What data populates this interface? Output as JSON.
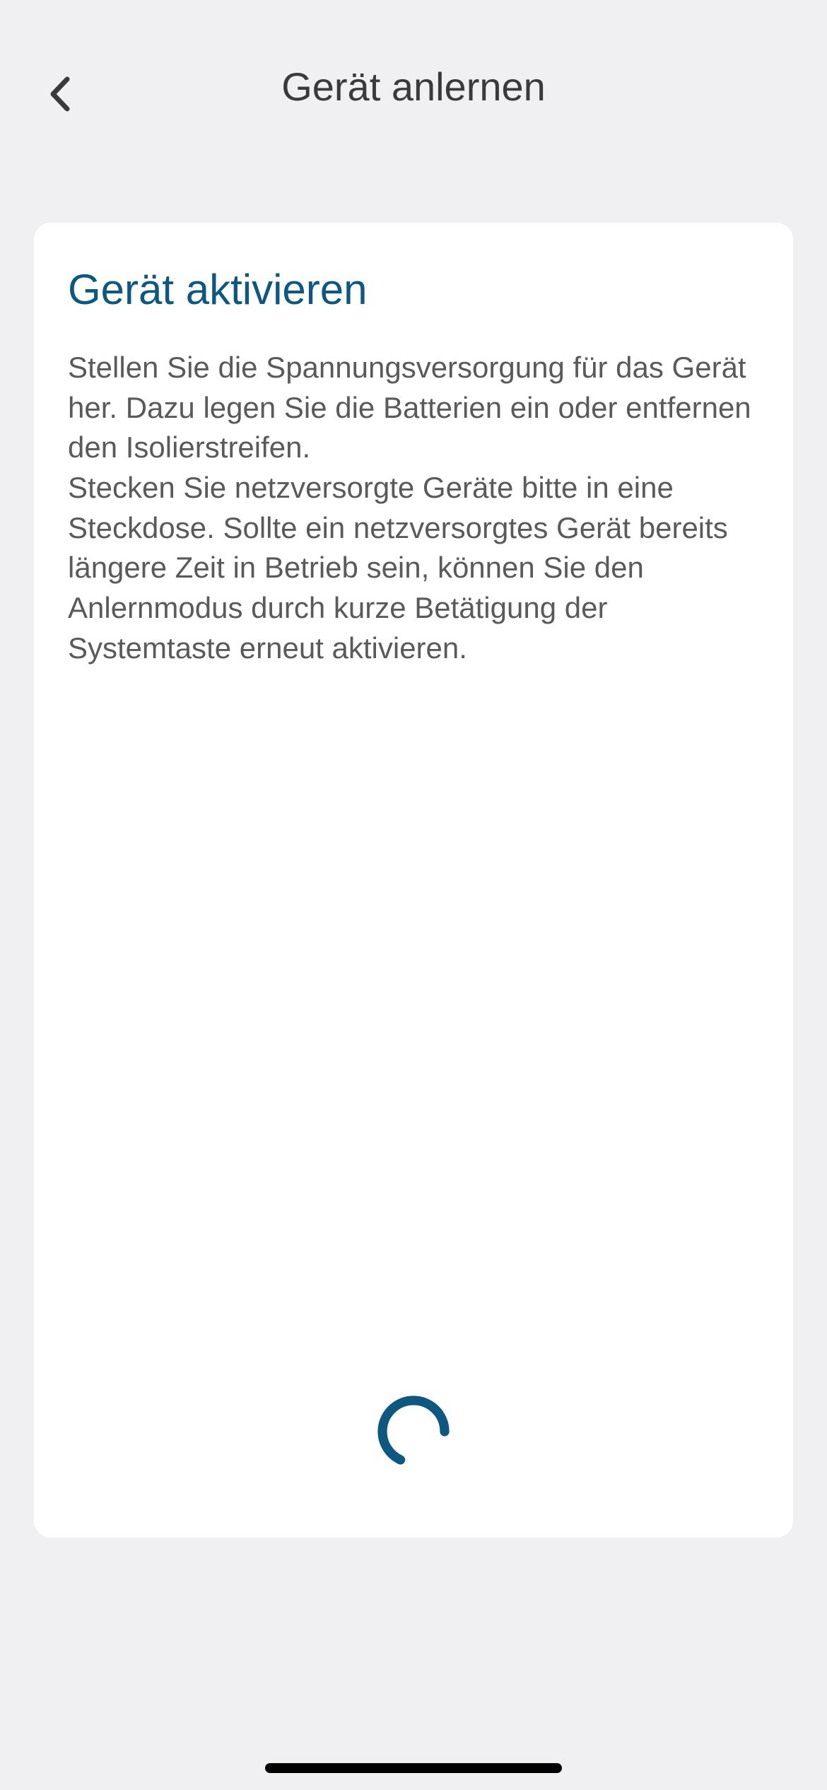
{
  "header": {
    "title": "Gerät anlernen"
  },
  "card": {
    "title": "Gerät aktivieren",
    "body": "Stellen Sie die Spannungsversorgung für das Gerät her. Dazu legen Sie die Batterien ein oder entfernen den Isolierstreifen.\nStecken Sie netzversorgte Geräte bitte in eine Steckdose. Sollte ein netzversorgtes Gerät bereits längere Zeit in Betrieb sein, können Sie den Anlernmodus durch kurze Betätigung der Systemtaste erneut aktivieren."
  },
  "colors": {
    "accent": "#0d5780",
    "background": "#f0f0f2",
    "cardBackground": "#ffffff",
    "textPrimary": "#3a3a3a",
    "textSecondary": "#5a5a5a"
  }
}
